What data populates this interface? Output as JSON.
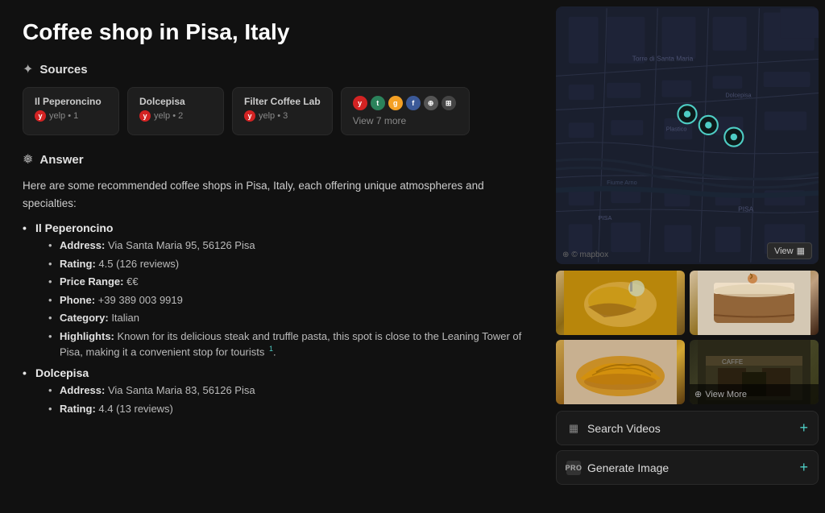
{
  "page": {
    "title": "Coffee shop in Pisa, Italy"
  },
  "sources": {
    "section_label": "Sources",
    "section_icon": "✦",
    "items": [
      {
        "name": "Il Peperoncino",
        "platform": "yelp",
        "num": "1"
      },
      {
        "name": "Dolcepisa",
        "platform": "yelp",
        "num": "2"
      },
      {
        "name": "Filter Coffee Lab",
        "platform": "yelp",
        "num": "3"
      }
    ],
    "more_count": "7",
    "view_more_label": "View 7 more"
  },
  "answer": {
    "section_label": "Answer",
    "section_icon": "❅",
    "intro": "Here are some recommended coffee shops in Pisa, Italy, each offering unique atmospheres and specialties:",
    "entries": [
      {
        "name": "Il Peperoncino",
        "details": [
          {
            "label": "Address:",
            "value": "Via Santa Maria 95, 56126 Pisa"
          },
          {
            "label": "Rating:",
            "value": "4.5 (126 reviews)"
          },
          {
            "label": "Price Range:",
            "value": "€€"
          },
          {
            "label": "Phone:",
            "value": "+39 389 003 9919"
          },
          {
            "label": "Category:",
            "value": "Italian"
          },
          {
            "label": "Highlights:",
            "value": "Known for its delicious steak and truffle pasta, this spot is close to the Leaning Tower of Pisa, making it a convenient stop for tourists",
            "ref": "1"
          }
        ]
      },
      {
        "name": "Dolcepisa",
        "details": [
          {
            "label": "Address:",
            "value": "Via Santa Maria 83, 56126 Pisa"
          },
          {
            "label": "Rating:",
            "value": "4.4 (13 reviews)"
          }
        ]
      }
    ]
  },
  "map": {
    "attribution": "© mapbox",
    "view_button": "View"
  },
  "photos": {
    "view_more_label": "View More"
  },
  "actions": [
    {
      "id": "search-videos",
      "label": "Search Videos",
      "icon": "▦",
      "plus": "+"
    },
    {
      "id": "generate-image",
      "label": "Generate Image",
      "icon": "PRO",
      "plus": "+"
    }
  ]
}
